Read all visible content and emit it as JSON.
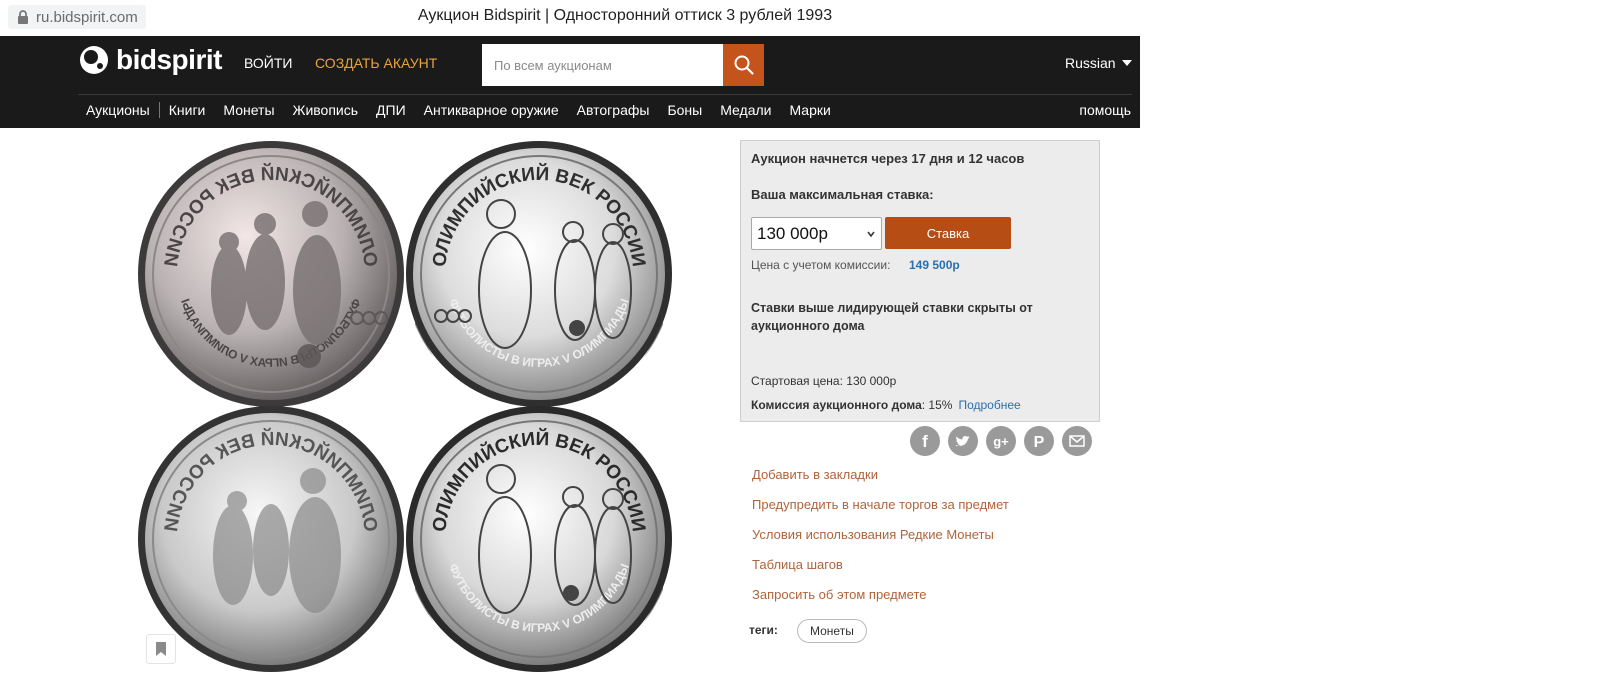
{
  "browser": {
    "url": "ru.bidspirit.com",
    "title": "Аукцион Bidspirit | Односторонний оттиск 3 рублей 1993"
  },
  "header": {
    "logo_text": "bidspirit",
    "login": "ВОЙТИ",
    "register": "СОЗДАТЬ АКАУНТ",
    "search_placeholder": "По всем аукционам",
    "language": "Russian",
    "help": "помощь",
    "nav": [
      "Аукционы",
      "Книги",
      "Монеты",
      "Живопись",
      "ДПИ",
      "Антикварное оружие",
      "Автографы",
      "Боны",
      "Медали",
      "Марки"
    ]
  },
  "coins": {
    "top_left_text": "ОЛИМПИЙСКИЙ ВЕК РОССИИ",
    "top_right_text": "ОЛИМПИЙСКИЙ ВЕК РОССИИ",
    "bottom_text": "ФУТБОЛИСТЫ В ИГРАХ V ОЛИМПИАДЫ"
  },
  "bid_panel": {
    "countdown": "Аукцион начнется через 17 дня и 12 часов",
    "max_bid_label": "Ваша максимальная ставка:",
    "bid_value": "130 000р",
    "bid_button": "Ставка",
    "commission_price_label": "Цена с учетом комиссии:",
    "commission_price_value": "149 500р",
    "hidden_note": "Ставки выше лидирующей ставки скрыты от аукционного дома",
    "start_price": "Стартовая цена: 130 000р",
    "house_commission_label": "Комиссия аукционного дома",
    "house_commission_value": ": 15%",
    "more_link": "Подробнее"
  },
  "share": [
    "f",
    "t",
    "g+",
    "p",
    "mail"
  ],
  "actions": {
    "bookmark": "Добавить в закладки",
    "notify": "Предупредить в начале торгов за предмет",
    "terms": "Условия использования Редкие Монеты",
    "steps": "Таблица шагов",
    "ask": "Запросить об этом предмете"
  },
  "tags": {
    "label": "теги:",
    "items": [
      "Монеты"
    ]
  }
}
